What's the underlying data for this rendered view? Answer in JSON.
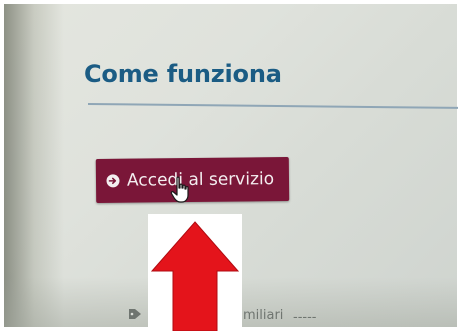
{
  "section": {
    "title": "Come funziona"
  },
  "access_button": {
    "label": "Accedi al servizio",
    "icon": "arrow-circle-right-icon"
  },
  "annotation": {
    "arrow_icon": "red-up-arrow-icon",
    "arrow_color": "#e4141b"
  },
  "footer_fragment": {
    "tag_icon": "tag-icon",
    "text_a": "miliari",
    "text_b": "-----"
  },
  "colors": {
    "title": "#1b5c84",
    "button_bg": "#7a1638",
    "button_text": "#f4eef0"
  }
}
